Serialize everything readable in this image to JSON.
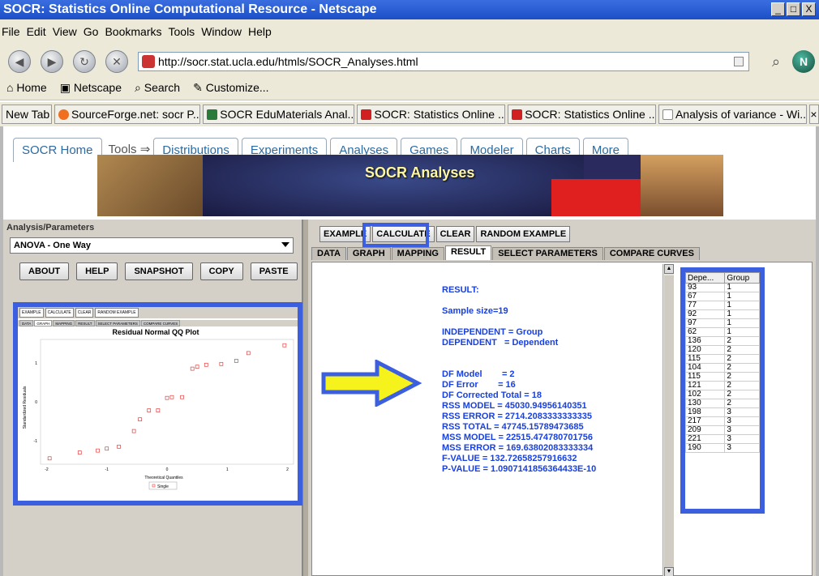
{
  "window": {
    "title": "SOCR: Statistics Online Computational Resource - Netscape",
    "controls": [
      "_",
      "□",
      "X"
    ]
  },
  "menu": [
    "File",
    "Edit",
    "View",
    "Go",
    "Bookmarks",
    "Tools",
    "Window",
    "Help"
  ],
  "address": {
    "url": "http://socr.stat.ucla.edu/htmls/SOCR_Analyses.html"
  },
  "bookmarks": [
    "Home",
    "Netscape",
    "Search",
    "Customize..."
  ],
  "browser_tabs": [
    {
      "label": "New Tab",
      "color": ""
    },
    {
      "label": "SourceForge.net: socr P...",
      "color": "#f07020"
    },
    {
      "label": "SOCR EduMaterials Anal...",
      "color": "#2a7a3a"
    },
    {
      "label": "SOCR: Statistics Online ...",
      "color": "#d02020"
    },
    {
      "label": "SOCR: Statistics Online ...",
      "color": "#d02020"
    },
    {
      "label": "Analysis of variance - Wi...",
      "color": "#888888"
    }
  ],
  "socr_nav": {
    "home": "SOCR Home",
    "tools": "Tools ⇒",
    "tabs": [
      "Distributions",
      "Experiments",
      "Analyses",
      "Games",
      "Modeler",
      "Charts",
      "More"
    ]
  },
  "banner": {
    "title": "SOCR Analyses"
  },
  "left": {
    "legend": "Analysis/Parameters",
    "selected_analysis": "ANOVA - One Way",
    "buttons": [
      "ABOUT",
      "HELP",
      "SNAPSHOT",
      "COPY",
      "PASTE"
    ]
  },
  "thumb": {
    "toolbar": [
      "EXAMPLE",
      "CALCULATE",
      "CLEAR",
      "RANDOM EXAMPLE"
    ],
    "tabs": [
      "DATA",
      "GRAPH",
      "MAPPING",
      "RESULT",
      "SELECT PARAMETERS",
      "COMPARE CURVES"
    ],
    "plot_title": "Residual Normal QQ Plot",
    "xlabel": "Theoretical Quantiles",
    "ylabel": "Standardized Residuals",
    "legend": "Single",
    "x_ticks": [
      "-2",
      "-1",
      "0",
      "1",
      "2"
    ],
    "y_ticks": [
      "1",
      "0",
      "-1"
    ]
  },
  "chart_data": {
    "type": "scatter",
    "title": "Residual Normal QQ Plot",
    "xlabel": "Theoretical Quantiles",
    "ylabel": "Standardized Residuals",
    "xlim": [
      -2.1,
      2.1
    ],
    "ylim": [
      -1.6,
      1.6
    ],
    "series": [
      {
        "name": "Single",
        "x": [
          -1.95,
          -1.45,
          -1.15,
          -1.0,
          -0.8,
          -0.55,
          -0.45,
          -0.3,
          -0.15,
          0.0,
          0.08,
          0.25,
          0.42,
          0.5,
          0.65,
          0.9,
          1.15,
          1.35,
          1.95
        ],
        "y": [
          -1.45,
          -1.3,
          -1.25,
          -1.2,
          -1.15,
          -0.75,
          -0.45,
          -0.22,
          -0.22,
          0.1,
          0.12,
          0.12,
          0.85,
          0.9,
          0.95,
          0.97,
          1.05,
          1.25,
          1.45
        ]
      }
    ]
  },
  "right": {
    "actions": [
      "EXAMPLE",
      "CALCULATE",
      "CLEAR",
      "RANDOM EXAMPLE"
    ],
    "tabs": [
      "DATA",
      "GRAPH",
      "MAPPING",
      "RESULT",
      "SELECT PARAMETERS",
      "COMPARE CURVES"
    ],
    "active_tab": "RESULT",
    "result_lines": [
      "RESULT:",
      "",
      "Sample size=19",
      "",
      "INDEPENDENT = Group",
      "DEPENDENT   = Dependent",
      "",
      "",
      "DF Model        = 2",
      "DF Error        = 16",
      "DF Corrected Total = 18",
      "RSS MODEL = 45030.94956140351",
      "RSS ERROR = 2714.2083333333335",
      "RSS TOTAL = 47745.15789473685",
      "MSS MODEL = 22515.474780701756",
      "MSS ERROR = 169.63802083333334",
      "F-VALUE = 132.72658257916632",
      "P-VALUE = 1.0907141856364433E-10"
    ],
    "table": {
      "headers": [
        "Depe...",
        "Group"
      ],
      "rows": [
        [
          "93",
          "1"
        ],
        [
          "67",
          "1"
        ],
        [
          "77",
          "1"
        ],
        [
          "92",
          "1"
        ],
        [
          "97",
          "1"
        ],
        [
          "62",
          "1"
        ],
        [
          "136",
          "2"
        ],
        [
          "120",
          "2"
        ],
        [
          "115",
          "2"
        ],
        [
          "104",
          "2"
        ],
        [
          "115",
          "2"
        ],
        [
          "121",
          "2"
        ],
        [
          "102",
          "2"
        ],
        [
          "130",
          "2"
        ],
        [
          "198",
          "3"
        ],
        [
          "217",
          "3"
        ],
        [
          "209",
          "3"
        ],
        [
          "221",
          "3"
        ],
        [
          "190",
          "3"
        ]
      ]
    }
  }
}
